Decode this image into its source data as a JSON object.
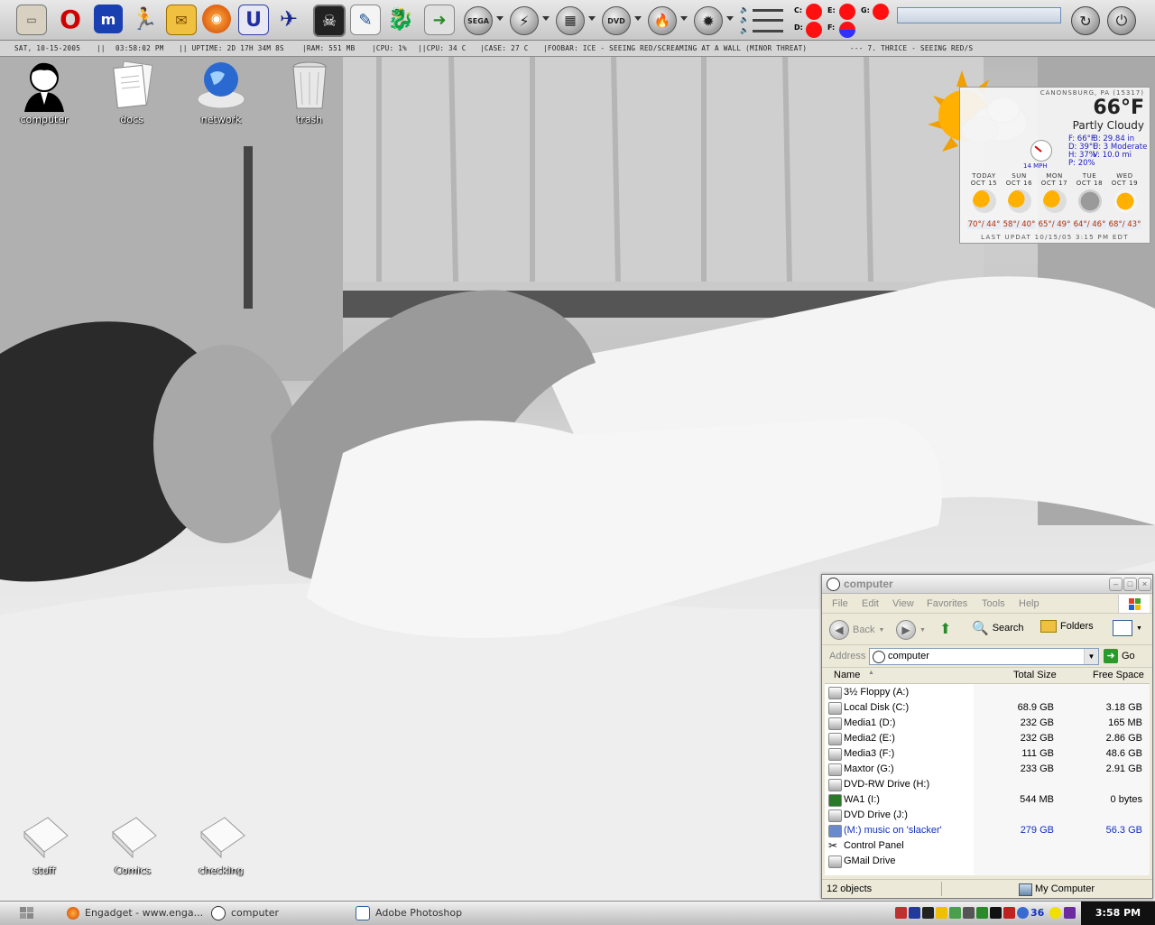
{
  "ticker": {
    "date": "SAT, 10-15-2005",
    "time": "03:58:02 PM",
    "uptime": "|| UPTIME: 2D 17H 34M 8S",
    "ram": "|RAM: 551 MB",
    "cpu": "|CPU: 1%",
    "cputemp": "||CPU: 34 C",
    "case": "|CASE: 27 C",
    "foobar": "|FOOBAR: ICE - SEEING RED/SCREAMING AT A WALL (MINOR THREAT)",
    "track": "---    7. THRICE - SEEING RED/S",
    "sep1": "||"
  },
  "toolbar": {
    "drive_labels": [
      "C:",
      "D:",
      "E:",
      "F:",
      "G:"
    ],
    "round_labels": [
      "SEGA",
      "DVD"
    ]
  },
  "desktop": {
    "top_icons": [
      {
        "label": "computer"
      },
      {
        "label": "docs"
      },
      {
        "label": "network"
      },
      {
        "label": "trash"
      }
    ],
    "bottom_icons": [
      {
        "label": "stuff"
      },
      {
        "label": "Comics"
      },
      {
        "label": "checking"
      }
    ]
  },
  "weather": {
    "location": "CANONSBURG, PA (15317)",
    "temp": "66°F",
    "condition": "Partly Cloudy",
    "wind": "14 MPH",
    "stats_left": [
      "F: 66°F",
      "D: 39°F",
      "H: 37%",
      "P: 20%"
    ],
    "stats_right": [
      "B: 29.84 in",
      "U: 3 Moderate",
      "V: 10.0 mi"
    ],
    "forecast": [
      {
        "day": "TODAY",
        "date": "OCT 15",
        "hilo": "70°/ 44°"
      },
      {
        "day": "SUN",
        "date": "OCT 16",
        "hilo": "58°/ 40°"
      },
      {
        "day": "MON",
        "date": "OCT 17",
        "hilo": "65°/ 49°"
      },
      {
        "day": "TUE",
        "date": "OCT 18",
        "hilo": "64°/ 46°"
      },
      {
        "day": "WED",
        "date": "OCT 19",
        "hilo": "68°/ 43°"
      }
    ],
    "updated": "LAST UPDAT 10/15/05 3:15 PM EDT"
  },
  "explorer": {
    "title": "computer",
    "menu": [
      "File",
      "Edit",
      "View",
      "Favorites",
      "Tools",
      "Help"
    ],
    "toolbar": {
      "back": "Back",
      "search": "Search",
      "folders": "Folders"
    },
    "address_label": "Address",
    "address_value": "computer",
    "go_label": "Go",
    "columns": {
      "name": "Name",
      "total": "Total Size",
      "free": "Free Space"
    },
    "rows": [
      {
        "name": "3½ Floppy (A:)",
        "total": "",
        "free": ""
      },
      {
        "name": "Local Disk (C:)",
        "total": "68.9 GB",
        "free": "3.18 GB"
      },
      {
        "name": "Media1 (D:)",
        "total": "232 GB",
        "free": "165 MB"
      },
      {
        "name": "Media2 (E:)",
        "total": "232 GB",
        "free": "2.86 GB"
      },
      {
        "name": "Media3 (F:)",
        "total": "111 GB",
        "free": "48.6 GB"
      },
      {
        "name": "Maxtor (G:)",
        "total": "233 GB",
        "free": "2.91 GB"
      },
      {
        "name": "DVD-RW Drive (H:)",
        "total": "",
        "free": ""
      },
      {
        "name": "WA1 (I:)",
        "total": "544 MB",
        "free": "0 bytes"
      },
      {
        "name": "DVD Drive (J:)",
        "total": "",
        "free": ""
      },
      {
        "name": "(M:) music on 'slacker'",
        "total": "279 GB",
        "free": "56.3 GB"
      },
      {
        "name": "Control Panel",
        "total": "",
        "free": ""
      },
      {
        "name": "GMail Drive",
        "total": "",
        "free": ""
      }
    ],
    "status_left": "12 objects",
    "status_right": "My Computer"
  },
  "taskbar": {
    "tasks": [
      {
        "label": "Engadget - www.enga..."
      },
      {
        "label": "computer"
      },
      {
        "label": "Adobe Photoshop"
      }
    ],
    "tray_number": "36",
    "clock": "3:58 PM"
  },
  "colors": {
    "led_red": "#ff1010",
    "link_blue": "#1030c0",
    "hilo_orange": "#b03000"
  }
}
